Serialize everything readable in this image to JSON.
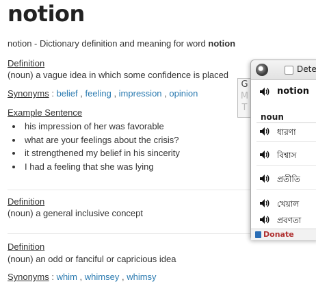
{
  "page": {
    "word": "notion",
    "subtitle_prefix": "notion - Dictionary definition and meaning for word ",
    "subtitle_word": "notion"
  },
  "definitions": [
    {
      "label": "Definition",
      "text": "(noun) a vague idea in which some confidence is placed",
      "synonyms_label": "Synonyms",
      "synonyms": [
        "belief",
        "feeling",
        "impression",
        "opinion"
      ],
      "example_label": "Example Sentence",
      "examples": [
        "his impression of her was favorable",
        "what are your feelings about the crisis?",
        "it strengthened my belief in his sincerity",
        "I had a feeling that she was lying"
      ]
    },
    {
      "label": "Definition",
      "text": "(noun) a general inclusive concept"
    },
    {
      "label": "Definition",
      "text": "(noun) an odd or fanciful or capricious idea",
      "synonyms_label": "Synonyms",
      "synonyms": [
        "whim",
        "whimsey",
        "whimsy"
      ]
    }
  ],
  "popup": {
    "detect_label": "Dete",
    "tab_letters": [
      "G",
      "M",
      "T"
    ],
    "entry_word": "notion",
    "pos": "noun",
    "translations": [
      "ধারণা",
      "বিশ্বাস",
      "প্রতীতি",
      "খেয়াল",
      "প্রবণতা"
    ],
    "donate_label": "Donate",
    "logo_icon": "translator-logo-icon",
    "speaker_icon": "speaker-icon"
  },
  "colors": {
    "link": "#2a7ab0",
    "text": "#333333",
    "donate": "#b03030"
  }
}
